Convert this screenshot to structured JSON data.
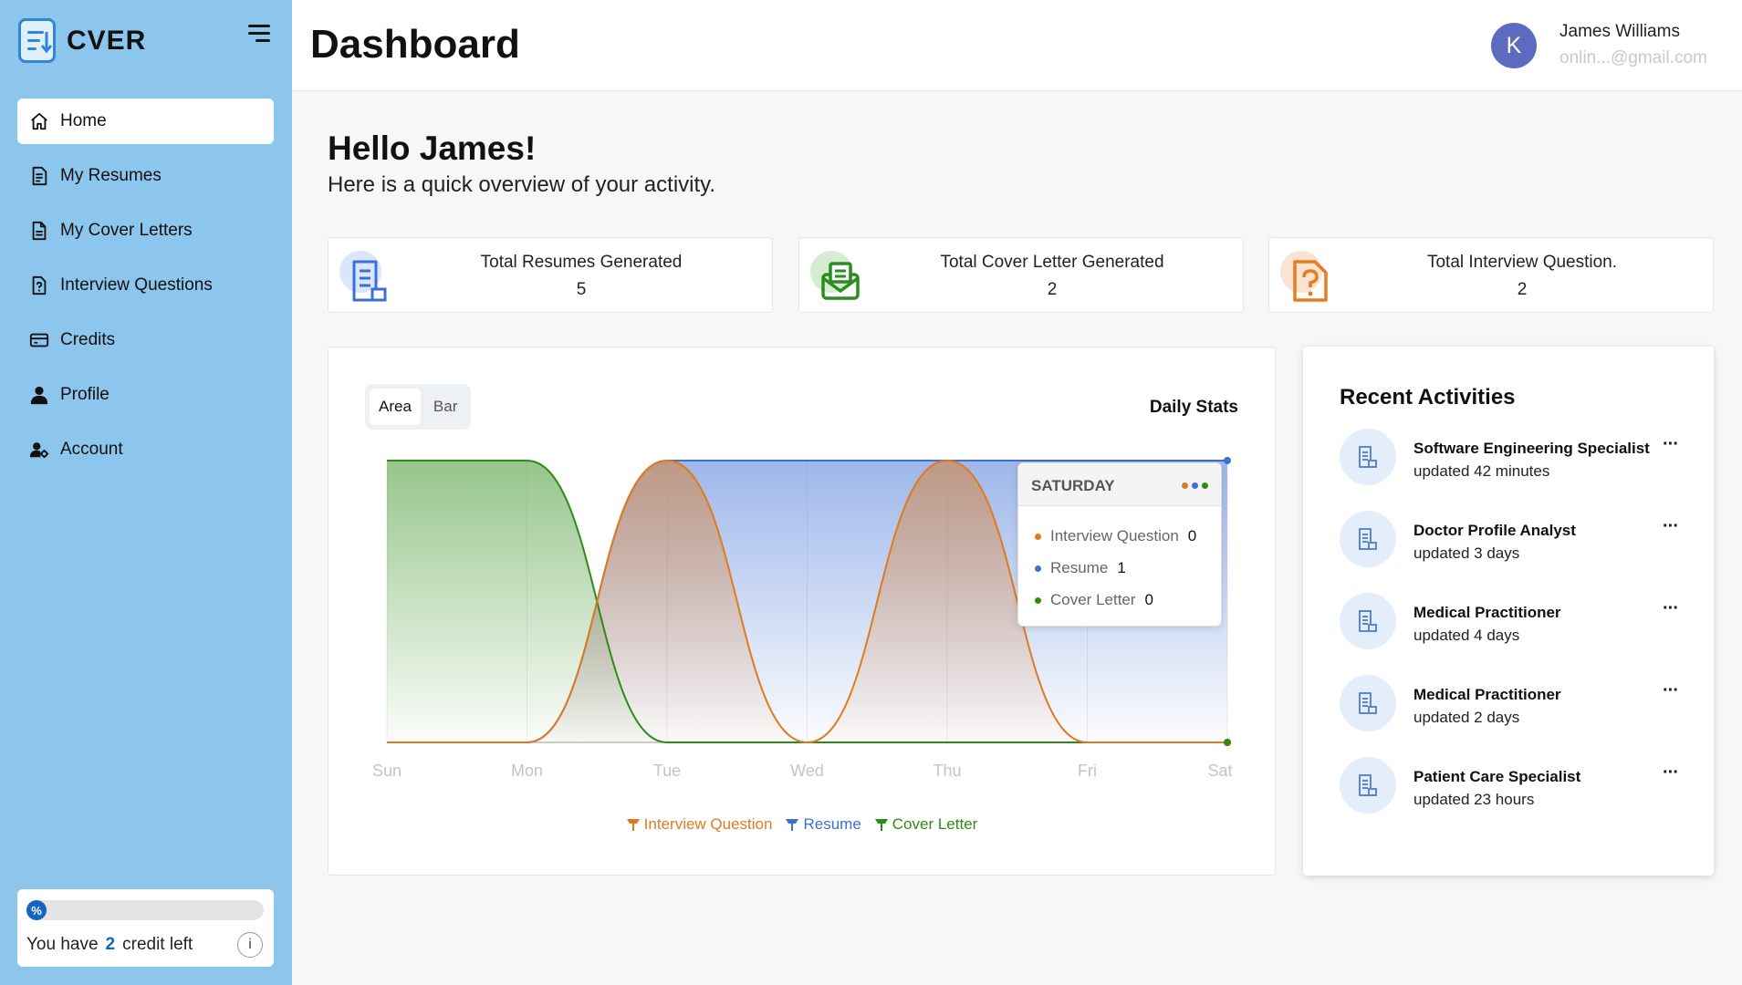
{
  "app": {
    "name": "CVER"
  },
  "header": {
    "title": "Dashboard",
    "user_name": "James Williams",
    "user_email": "onlin...@gmail.com",
    "avatar_initial": "K"
  },
  "sidebar": {
    "items": [
      {
        "label": "Home",
        "icon": "home-icon",
        "active": true
      },
      {
        "label": "My Resumes",
        "icon": "document-icon"
      },
      {
        "label": "My Cover Letters",
        "icon": "file-icon"
      },
      {
        "label": "Interview Questions",
        "icon": "question-file-icon"
      },
      {
        "label": "Credits",
        "icon": "credit-card-icon"
      },
      {
        "label": "Profile",
        "icon": "user-icon"
      },
      {
        "label": "Account",
        "icon": "user-gear-icon"
      }
    ],
    "credits": {
      "progress_symbol": "%",
      "text_before": "You have",
      "count": "2",
      "text_after": "credit left",
      "info": "i"
    }
  },
  "greeting": {
    "title": "Hello James!",
    "subtitle": "Here is a quick overview of your activity."
  },
  "stats": [
    {
      "label": "Total Resumes Generated",
      "value": "5",
      "icon": "resume-icon",
      "color": "#3a6fd8",
      "blob": "#dbe6fb"
    },
    {
      "label": "Total Cover Letter Generated",
      "value": "2",
      "icon": "mail-envelope-icon",
      "color": "#2e8b22",
      "blob": "#d6ecd2"
    },
    {
      "label": "Total Interview Question.",
      "value": "2",
      "icon": "question-document-icon",
      "color": "#e87c1e",
      "blob": "#fbe3d2"
    }
  ],
  "chart_controls": {
    "area_label": "Area",
    "bar_label": "Bar",
    "selected": "Area"
  },
  "chart_data": {
    "type": "area",
    "title": "Daily Stats",
    "categories": [
      "Sun",
      "Mon",
      "Tue",
      "Wed",
      "Thu",
      "Fri",
      "Sat"
    ],
    "ylim": [
      0,
      1
    ],
    "series": [
      {
        "name": "Interview Question",
        "color": "#e07a1f",
        "values": [
          0,
          0,
          1,
          0,
          1,
          0,
          0
        ]
      },
      {
        "name": "Resume",
        "color": "#3d6fd4",
        "values": [
          0,
          0,
          1,
          1,
          1,
          1,
          1
        ]
      },
      {
        "name": "Cover Letter",
        "color": "#2e8b18",
        "values": [
          1,
          1,
          0,
          0,
          0,
          0,
          0
        ]
      }
    ],
    "legend_position": "bottom-center",
    "grid": true,
    "tooltip": {
      "title": "SATURDAY",
      "rows": [
        {
          "name": "Interview Question",
          "value": "0",
          "color": "#e07a1f"
        },
        {
          "name": "Resume",
          "value": "1",
          "color": "#3d6fd4"
        },
        {
          "name": "Cover Letter",
          "value": "0",
          "color": "#2e8b18"
        }
      ]
    }
  },
  "activities": {
    "title": "Recent Activities",
    "more": "···",
    "items": [
      {
        "name": "Software Engineering Specialist",
        "time": "updated 42 minutes"
      },
      {
        "name": "Doctor Profile Analyst",
        "time": "updated 3 days"
      },
      {
        "name": "Medical Practitioner",
        "time": "updated 4 days"
      },
      {
        "name": "Medical Practitioner",
        "time": "updated 2 days"
      },
      {
        "name": "Patient Care Specialist",
        "time": "updated 23 hours"
      }
    ]
  }
}
